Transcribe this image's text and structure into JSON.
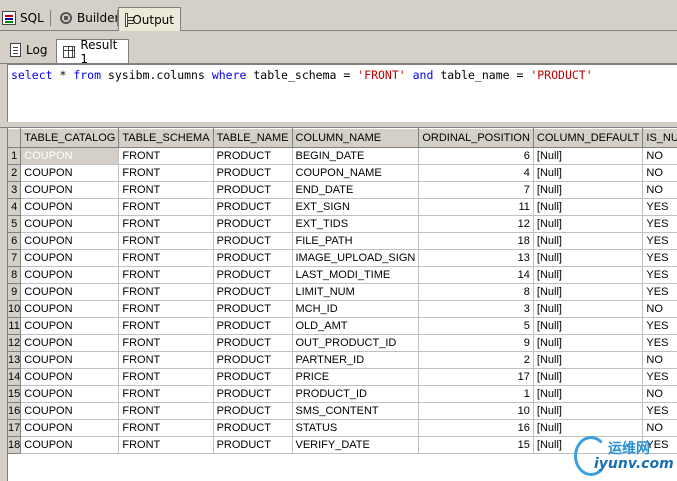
{
  "top_tabs": [
    {
      "label": "SQL",
      "icon": "sql-icon"
    },
    {
      "label": "Builder",
      "icon": "builder-icon"
    },
    {
      "label": "Output",
      "icon": "output-icon"
    }
  ],
  "sub_tabs": [
    {
      "label": "Log",
      "icon": "log-icon"
    },
    {
      "label": "Result 1",
      "icon": "result-grid-icon"
    }
  ],
  "editor": {
    "select": "select",
    "star": " * ",
    "from": "from",
    "table": " sysibm.columns ",
    "where": "where",
    "cond1": " table_schema = ",
    "val1": "'FRONT'",
    "and": " and ",
    "cond2": "table_name = ",
    "val2": "'PRODUCT'"
  },
  "grid": {
    "columns": [
      "TABLE_CATALOG",
      "TABLE_SCHEMA",
      "TABLE_NAME",
      "COLUMN_NAME",
      "ORDINAL_POSITION",
      "COLUMN_DEFAULT",
      "IS_NU"
    ],
    "rows": [
      [
        "1",
        "COUPON",
        "FRONT",
        "PRODUCT",
        "BEGIN_DATE",
        "6",
        "[Null]",
        "NO"
      ],
      [
        "2",
        "COUPON",
        "FRONT",
        "PRODUCT",
        "COUPON_NAME",
        "4",
        "[Null]",
        "NO"
      ],
      [
        "3",
        "COUPON",
        "FRONT",
        "PRODUCT",
        "END_DATE",
        "7",
        "[Null]",
        "NO"
      ],
      [
        "4",
        "COUPON",
        "FRONT",
        "PRODUCT",
        "EXT_SIGN",
        "11",
        "[Null]",
        "YES"
      ],
      [
        "5",
        "COUPON",
        "FRONT",
        "PRODUCT",
        "EXT_TIDS",
        "12",
        "[Null]",
        "YES"
      ],
      [
        "6",
        "COUPON",
        "FRONT",
        "PRODUCT",
        "FILE_PATH",
        "18",
        "[Null]",
        "YES"
      ],
      [
        "7",
        "COUPON",
        "FRONT",
        "PRODUCT",
        "IMAGE_UPLOAD_SIGN",
        "13",
        "[Null]",
        "YES"
      ],
      [
        "8",
        "COUPON",
        "FRONT",
        "PRODUCT",
        "LAST_MODI_TIME",
        "14",
        "[Null]",
        "YES"
      ],
      [
        "9",
        "COUPON",
        "FRONT",
        "PRODUCT",
        "LIMIT_NUM",
        "8",
        "[Null]",
        "YES"
      ],
      [
        "10",
        "COUPON",
        "FRONT",
        "PRODUCT",
        "MCH_ID",
        "3",
        "[Null]",
        "NO"
      ],
      [
        "11",
        "COUPON",
        "FRONT",
        "PRODUCT",
        "OLD_AMT",
        "5",
        "[Null]",
        "YES"
      ],
      [
        "12",
        "COUPON",
        "FRONT",
        "PRODUCT",
        "OUT_PRODUCT_ID",
        "9",
        "[Null]",
        "YES"
      ],
      [
        "13",
        "COUPON",
        "FRONT",
        "PRODUCT",
        "PARTNER_ID",
        "2",
        "[Null]",
        "NO"
      ],
      [
        "14",
        "COUPON",
        "FRONT",
        "PRODUCT",
        "PRICE",
        "17",
        "[Null]",
        "YES"
      ],
      [
        "15",
        "COUPON",
        "FRONT",
        "PRODUCT",
        "PRODUCT_ID",
        "1",
        "[Null]",
        "NO"
      ],
      [
        "16",
        "COUPON",
        "FRONT",
        "PRODUCT",
        "SMS_CONTENT",
        "10",
        "[Null]",
        "YES"
      ],
      [
        "17",
        "COUPON",
        "FRONT",
        "PRODUCT",
        "STATUS",
        "16",
        "[Null]",
        "NO"
      ],
      [
        "18",
        "COUPON",
        "FRONT",
        "PRODUCT",
        "VERIFY_DATE",
        "15",
        "[Null]",
        "YES"
      ]
    ]
  },
  "watermark": {
    "chinese": "运维网",
    "url": "iyunv.com"
  },
  "colors": {
    "keyword": "#0000ff",
    "string": "#c00000",
    "chrome": "#d4d0c8"
  }
}
